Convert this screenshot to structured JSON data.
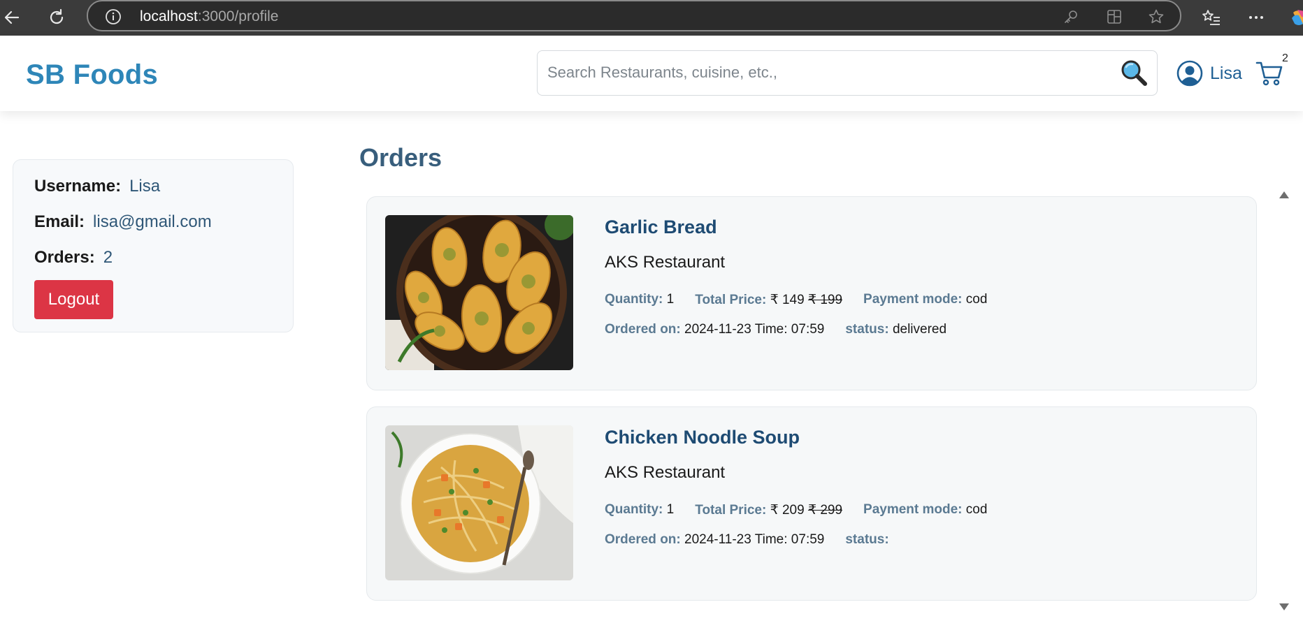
{
  "browser": {
    "url_host": "localhost",
    "url_path": ":3000/profile"
  },
  "header": {
    "brand": "SB Foods",
    "search_placeholder": "Search Restaurants, cuisine, etc.,",
    "user_name": "Lisa",
    "cart_count": "2"
  },
  "profile": {
    "username_label": "Username:",
    "username_value": "Lisa",
    "email_label": "Email:",
    "email_value": "lisa@gmail.com",
    "orders_label": "Orders:",
    "orders_value": "2",
    "logout_label": "Logout"
  },
  "orders": {
    "title": "Orders",
    "items": [
      {
        "name": "Garlic Bread",
        "restaurant": "AKS Restaurant",
        "quantity_label": "Quantity:",
        "quantity": "1",
        "total_price_label": "Total Price:",
        "price": "₹ 149",
        "original_price": "₹ 199",
        "payment_label": "Payment mode:",
        "payment": "cod",
        "ordered_label": "Ordered on:",
        "ordered_on": "2024-11-23 Time: 07:59",
        "status_label": "status:",
        "status": "delivered",
        "image_icon": "garlic-bread-photo"
      },
      {
        "name": "Chicken Noodle Soup",
        "restaurant": "AKS Restaurant",
        "quantity_label": "Quantity:",
        "quantity": "1",
        "total_price_label": "Total Price:",
        "price": "₹ 209",
        "original_price": "₹ 299",
        "payment_label": "Payment mode:",
        "payment": "cod",
        "ordered_label": "Ordered on:",
        "ordered_on": "2024-11-23 Time: 07:59",
        "status_label": "status:",
        "status": "",
        "image_icon": "noodle-soup-photo"
      }
    ]
  },
  "colors": {
    "brand": "#2e86b8",
    "logout": "#dc3545",
    "heading": "#385e7c",
    "label": "#5b7a92"
  }
}
